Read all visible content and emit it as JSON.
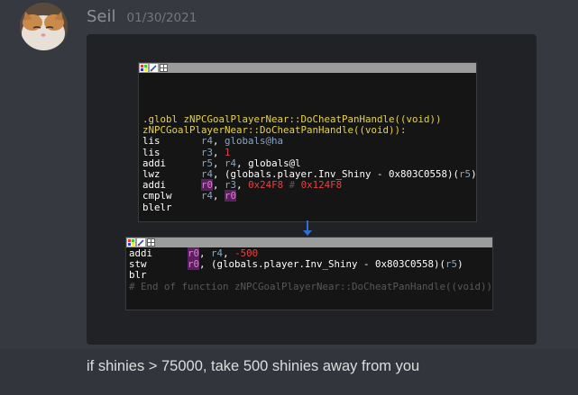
{
  "message": {
    "username": "Seil",
    "timestamp": "01/30/2021",
    "text": "if shinies > 75000, take 500 shinies away from you"
  },
  "code_top": {
    "lines": [
      [
        {
          "t": ".globl zNPCGoalPlayerNear::DoCheatPanHandle((void))",
          "c": "c-yellow"
        }
      ],
      [
        {
          "t": "zNPCGoalPlayerNear::DoCheatPanHandle((void)):",
          "c": "c-yellow"
        }
      ],
      [
        {
          "t": "lis       ",
          "c": "c-white"
        },
        {
          "t": "r4",
          "c": "c-reg"
        },
        {
          "t": ", ",
          "c": "c-white"
        },
        {
          "t": "globals@ha",
          "c": "c-reg"
        }
      ],
      [
        {
          "t": "lis       ",
          "c": "c-white"
        },
        {
          "t": "r3",
          "c": "c-reg"
        },
        {
          "t": ", ",
          "c": "c-white"
        },
        {
          "t": "1",
          "c": "c-red"
        }
      ],
      [
        {
          "t": "addi      ",
          "c": "c-white"
        },
        {
          "t": "r5",
          "c": "c-reg"
        },
        {
          "t": ", ",
          "c": "c-white"
        },
        {
          "t": "r4",
          "c": "c-reg"
        },
        {
          "t": ", globals@l",
          "c": "c-white"
        }
      ],
      [
        {
          "t": "lwz       ",
          "c": "c-white"
        },
        {
          "t": "r4",
          "c": "c-reg"
        },
        {
          "t": ", (globals.player.Inv_Shiny - 0x803C0558)(",
          "c": "c-white"
        },
        {
          "t": "r5",
          "c": "c-reg"
        },
        {
          "t": ")",
          "c": "c-white"
        }
      ],
      [
        {
          "t": "addi      ",
          "c": "c-white"
        },
        {
          "t": "r0",
          "c": "c-hl"
        },
        {
          "t": ", ",
          "c": "c-white"
        },
        {
          "t": "r3",
          "c": "c-reg"
        },
        {
          "t": ", ",
          "c": "c-white"
        },
        {
          "t": "0x24F8",
          "c": "c-red"
        },
        {
          "t": " # ",
          "c": "c-gray"
        },
        {
          "t": "0x124F8",
          "c": "c-red"
        }
      ],
      [
        {
          "t": "cmplw     ",
          "c": "c-white"
        },
        {
          "t": "r4",
          "c": "c-reg"
        },
        {
          "t": ", ",
          "c": "c-white"
        },
        {
          "t": "r0",
          "c": "c-hl"
        }
      ],
      [
        {
          "t": "blelr",
          "c": "c-white"
        }
      ]
    ]
  },
  "code_bottom": {
    "lines": [
      [
        {
          "t": "addi      ",
          "c": "c-white"
        },
        {
          "t": "r0",
          "c": "c-hl"
        },
        {
          "t": ", ",
          "c": "c-white"
        },
        {
          "t": "r4",
          "c": "c-reg"
        },
        {
          "t": ", ",
          "c": "c-white"
        },
        {
          "t": "-500",
          "c": "c-red"
        }
      ],
      [
        {
          "t": "stw       ",
          "c": "c-white"
        },
        {
          "t": "r0",
          "c": "c-hl"
        },
        {
          "t": ", (globals.player.Inv_Shiny - 0x803C0558)(",
          "c": "c-white"
        },
        {
          "t": "r5",
          "c": "c-reg"
        },
        {
          "t": ")",
          "c": "c-white"
        }
      ],
      [
        {
          "t": "blr",
          "c": "c-white"
        }
      ],
      [
        {
          "t": "# End of function zNPCGoalPlayerNear::DoCheatPanHandle((void))",
          "c": "c-gray"
        }
      ]
    ]
  }
}
